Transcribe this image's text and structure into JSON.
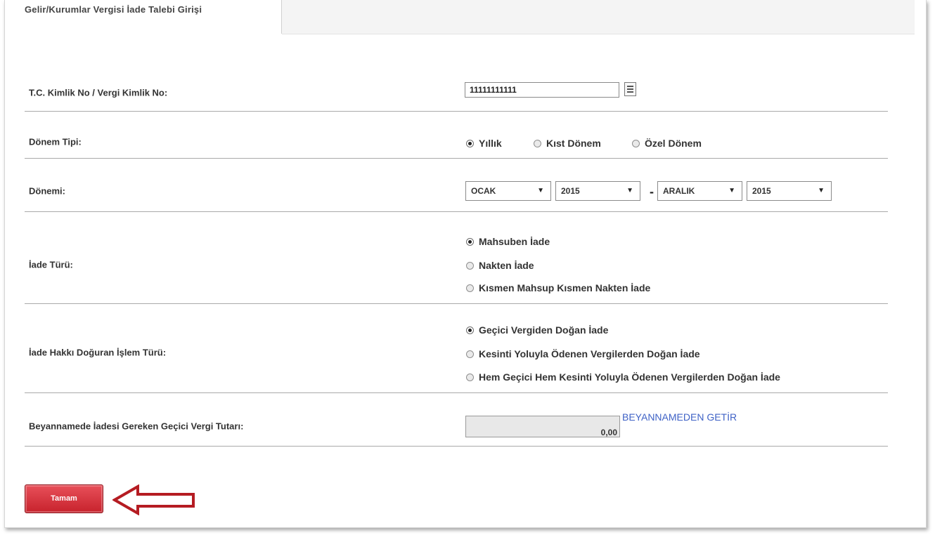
{
  "tab": {
    "title": "Gelir/Kurumlar Vergisi İade Talebi Girişi"
  },
  "form": {
    "tc_label": "T.C. Kimlik No / Vergi Kimlik No:",
    "tc_value": "11111111111",
    "donem_tipi_label": "Dönem Tipi:",
    "donem_tipi_options": [
      "Yıllık",
      "Kıst Dönem",
      "Özel Dönem"
    ],
    "donem_tipi_selected": "Yıllık",
    "donemi_label": "Dönemi:",
    "start_month": "OCAK",
    "start_year": "2015",
    "period_separator": "-",
    "end_month": "ARALIK",
    "end_year": "2015",
    "iade_turu_label": "İade Türü:",
    "iade_turu_options": [
      "Mahsuben İade",
      "Nakten İade",
      "Kısmen Mahsup Kısmen Nakten İade"
    ],
    "iade_turu_selected": "Mahsuben İade",
    "islem_turu_label": "İade Hakkı Doğuran İşlem Türü:",
    "islem_turu_options": [
      "Geçici Vergiden Doğan İade",
      "Kesinti Yoluyla Ödenen Vergilerden Doğan İade",
      "Hem Geçici Hem Kesinti Yoluyla Ödenen Vergilerden Doğan İade"
    ],
    "islem_turu_selected": "Geçici Vergiden Doğan İade",
    "tutar_label": "Beyannamede İadesi Gereken Geçici Vergi Tutarı:",
    "tutar_value": "0,00",
    "getir_link": "BEYANNAMEDEN GETİR"
  },
  "actions": {
    "submit_label": "Tamam"
  },
  "colors": {
    "button": "#c7222c",
    "link": "#3f62c6",
    "annotation_arrow": "#b51c22"
  },
  "icons": {
    "list_icon": "list-icon",
    "annotation": "left-arrow-icon"
  }
}
